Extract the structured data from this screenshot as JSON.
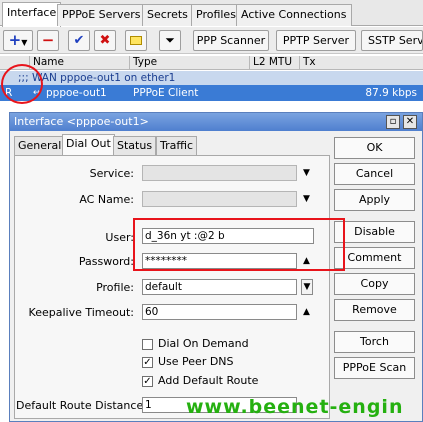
{
  "top_tabs": [
    "Interface",
    "PPPoE Servers",
    "Secrets",
    "Profiles",
    "Active Connections"
  ],
  "toolbar": {
    "ppp_scanner": "PPP Scanner",
    "pptp_server": "PPTP Server",
    "sstp_server": "SSTP Serve"
  },
  "list": {
    "columns": [
      "Name",
      "Type",
      "L2 MTU",
      "Tx"
    ],
    "comment": ";;; WAN pppoe-out1 on ether1",
    "row": {
      "flag": "R",
      "name": "pppoe-out1",
      "type": "PPPoE Client",
      "tx": "87.9 kbps"
    }
  },
  "dialog": {
    "title": "Interface <pppoe-out1>",
    "tabs": [
      "General",
      "Dial Out",
      "Status",
      "Traffic"
    ],
    "fields": {
      "service_label": "Service:",
      "ac_name_label": "AC Name:",
      "user_label": "User:",
      "user_value": "d_36n  yt  :@2  b",
      "password_label": "Password:",
      "password_value": "********",
      "profile_label": "Profile:",
      "profile_value": "default",
      "keepalive_label": "Keepalive Timeout:",
      "keepalive_value": "60",
      "distance_label": "Default Route Distance:",
      "distance_value": "1"
    },
    "checkboxes": {
      "dial_on_demand": "Dial On Demand",
      "use_peer_dns": "Use Peer DNS",
      "add_default_route": "Add Default Route"
    },
    "buttons": [
      "OK",
      "Cancel",
      "Apply",
      "Disable",
      "Comment",
      "Copy",
      "Remove",
      "Torch",
      "PPPoE Scan"
    ]
  },
  "watermark": "www.beenet-engin",
  "colors": {
    "highlight": "#e8141b",
    "selection": "#3a7bd5",
    "watermark": "#25b010"
  }
}
